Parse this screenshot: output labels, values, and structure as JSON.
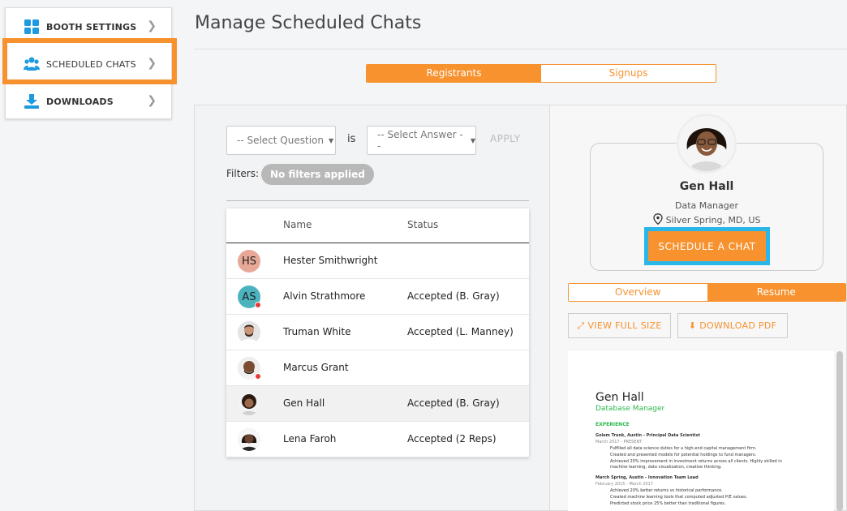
{
  "sidebar": {
    "items": [
      {
        "label": "BOOTH SETTINGS",
        "icon": "grid-icon"
      },
      {
        "label": "SCHEDULED CHATS",
        "icon": "users-icon"
      },
      {
        "label": "DOWNLOADS",
        "icon": "download-icon"
      }
    ]
  },
  "header": {
    "title": "Manage Scheduled Chats"
  },
  "top_tabs": [
    {
      "label": "Registrants",
      "active": true
    },
    {
      "label": "Signups",
      "active": false
    }
  ],
  "filters": {
    "question_placeholder": "-- Select Question",
    "is_label": "is",
    "answer_placeholder": "-- Select Answer --",
    "apply_label": "APPLY",
    "filters_label": "Filters:",
    "no_filters": "No filters applied"
  },
  "table": {
    "headers": {
      "name": "Name",
      "status": "Status"
    },
    "rows": [
      {
        "initials": "HS",
        "name": "Hester Smithwright",
        "status": ""
      },
      {
        "initials": "AS",
        "name": "Alvin Strathmore",
        "status": "Accepted (B. Gray)"
      },
      {
        "initials": "",
        "name": "Truman White",
        "status": "Accepted (L. Manney)"
      },
      {
        "initials": "",
        "name": "Marcus Grant",
        "status": ""
      },
      {
        "initials": "",
        "name": "Gen Hall",
        "status": "Accepted (B. Gray)"
      },
      {
        "initials": "",
        "name": "Lena Faroh",
        "status": "Accepted (2 Reps)"
      }
    ]
  },
  "profile": {
    "name": "Gen Hall",
    "role": "Data Manager",
    "location": "Silver Spring, MD, US",
    "schedule_label": "SCHEDULE A CHAT"
  },
  "detail_tabs": [
    {
      "label": "Overview",
      "active": false
    },
    {
      "label": "Resume",
      "active": true
    }
  ],
  "tools": {
    "view_full": "VIEW FULL SIZE",
    "download_pdf": "DOWNLOAD PDF"
  },
  "resume": {
    "name": "Gen Hall",
    "title": "Database Manager",
    "section": "EXPERIENCE",
    "job1": "Golem Trunk, Austin - Principal Data Scientist",
    "job1_dates": "March 2017 - PRESENT",
    "job1_b1": "Fulfilled all data science duties for a high-end capital management firm.",
    "job1_b2": "Created and presented models for potential holdings to fund managers.",
    "job1_b3": "Achieved 20% improvement in investment returns across all clients. Highly skilled in",
    "job1_b3b": "machine learning, data visualization, creative thinking.",
    "job2": "March Spring, Austin - Innovation Team Lead",
    "job2_dates": "February 2015 - March 2017",
    "job2_b1": "Achieved 20% better returns vs historical performance.",
    "job2_b2": "Created machine learning tools that computed adjusted P/E values.",
    "job2_b3": "Predicted stock price 25% better than traditional figures."
  },
  "colors": {
    "accent": "#f7922f",
    "highlight_blue": "#29b6e8",
    "presence_dot": "#e53935"
  }
}
